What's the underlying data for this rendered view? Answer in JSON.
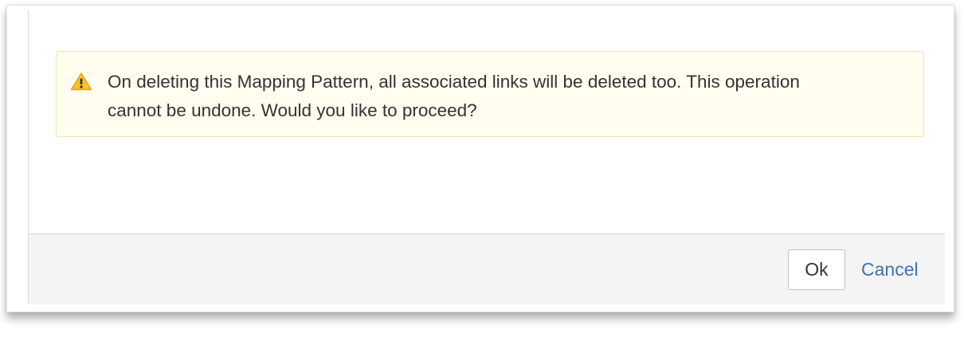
{
  "dialog": {
    "message": "On deleting this Mapping Pattern, all associated links will be deleted too. This operation cannot be undone. Would you like to proceed?",
    "icon": "warning-icon",
    "ok_label": "Ok",
    "cancel_label": "Cancel"
  },
  "colors": {
    "warning_background": "#fffdf0",
    "warning_border": "#f1e3a4",
    "warning_icon": "#f4c22b",
    "link": "#3b73af",
    "footer_background": "#f4f4f4"
  }
}
